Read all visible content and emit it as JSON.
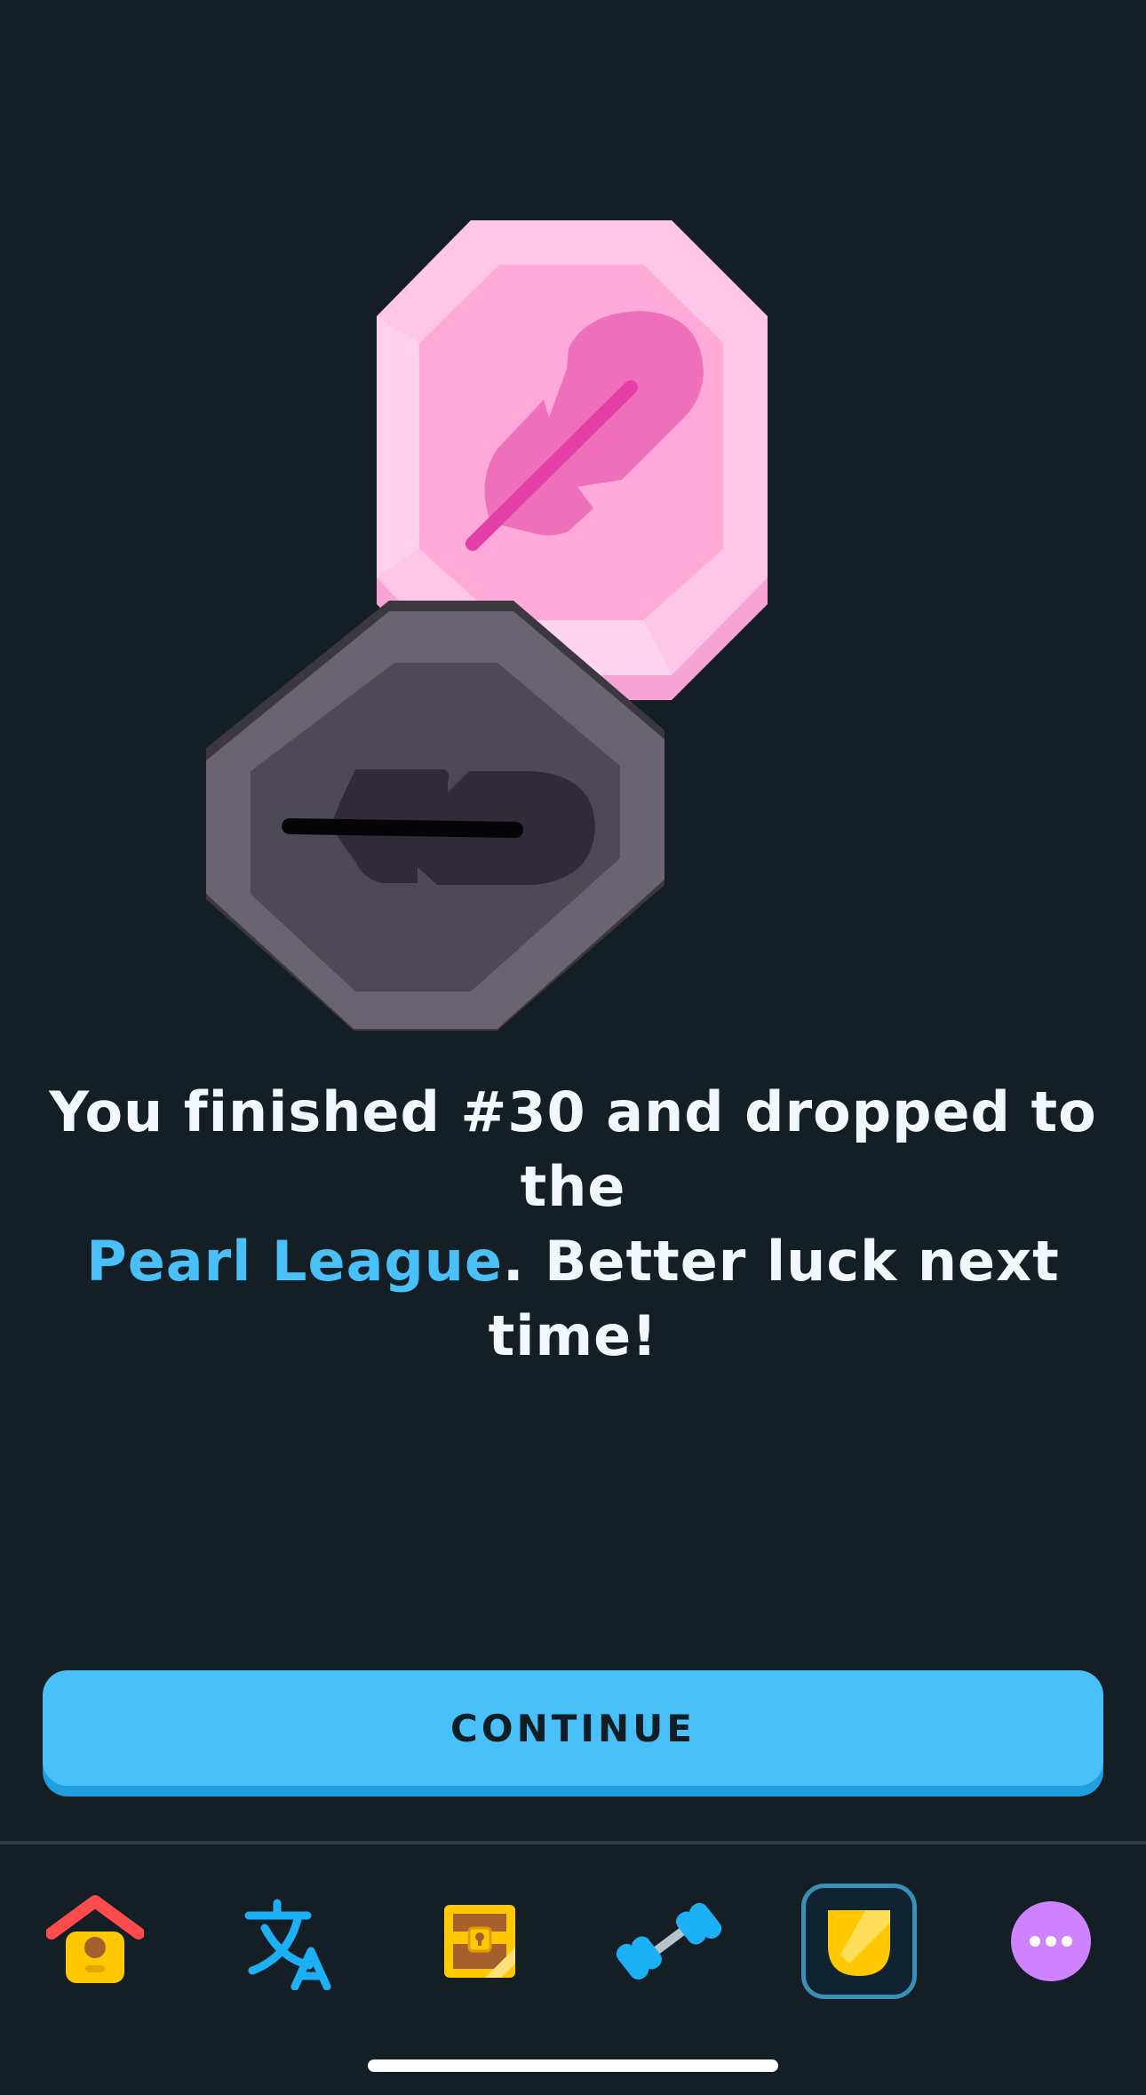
{
  "message": {
    "part1": "You finished #30 and dropped to the",
    "league": "Pearl League",
    "part2": ". Better luck next time!"
  },
  "continue_label": "CONTINUE",
  "nav": {
    "items": [
      {
        "name": "home",
        "icon": "home-icon"
      },
      {
        "name": "translate",
        "icon": "translate-icon"
      },
      {
        "name": "chest",
        "icon": "treasure-chest-icon"
      },
      {
        "name": "practice",
        "icon": "dumbbell-icon"
      },
      {
        "name": "leagues",
        "icon": "shield-icon",
        "active": true
      },
      {
        "name": "more",
        "icon": "more-icon"
      }
    ]
  },
  "colors": {
    "background": "#131f24",
    "accent": "#49c0f8",
    "pearl_badge": "#ffa8d8",
    "locked_badge": "#4e4a55"
  }
}
